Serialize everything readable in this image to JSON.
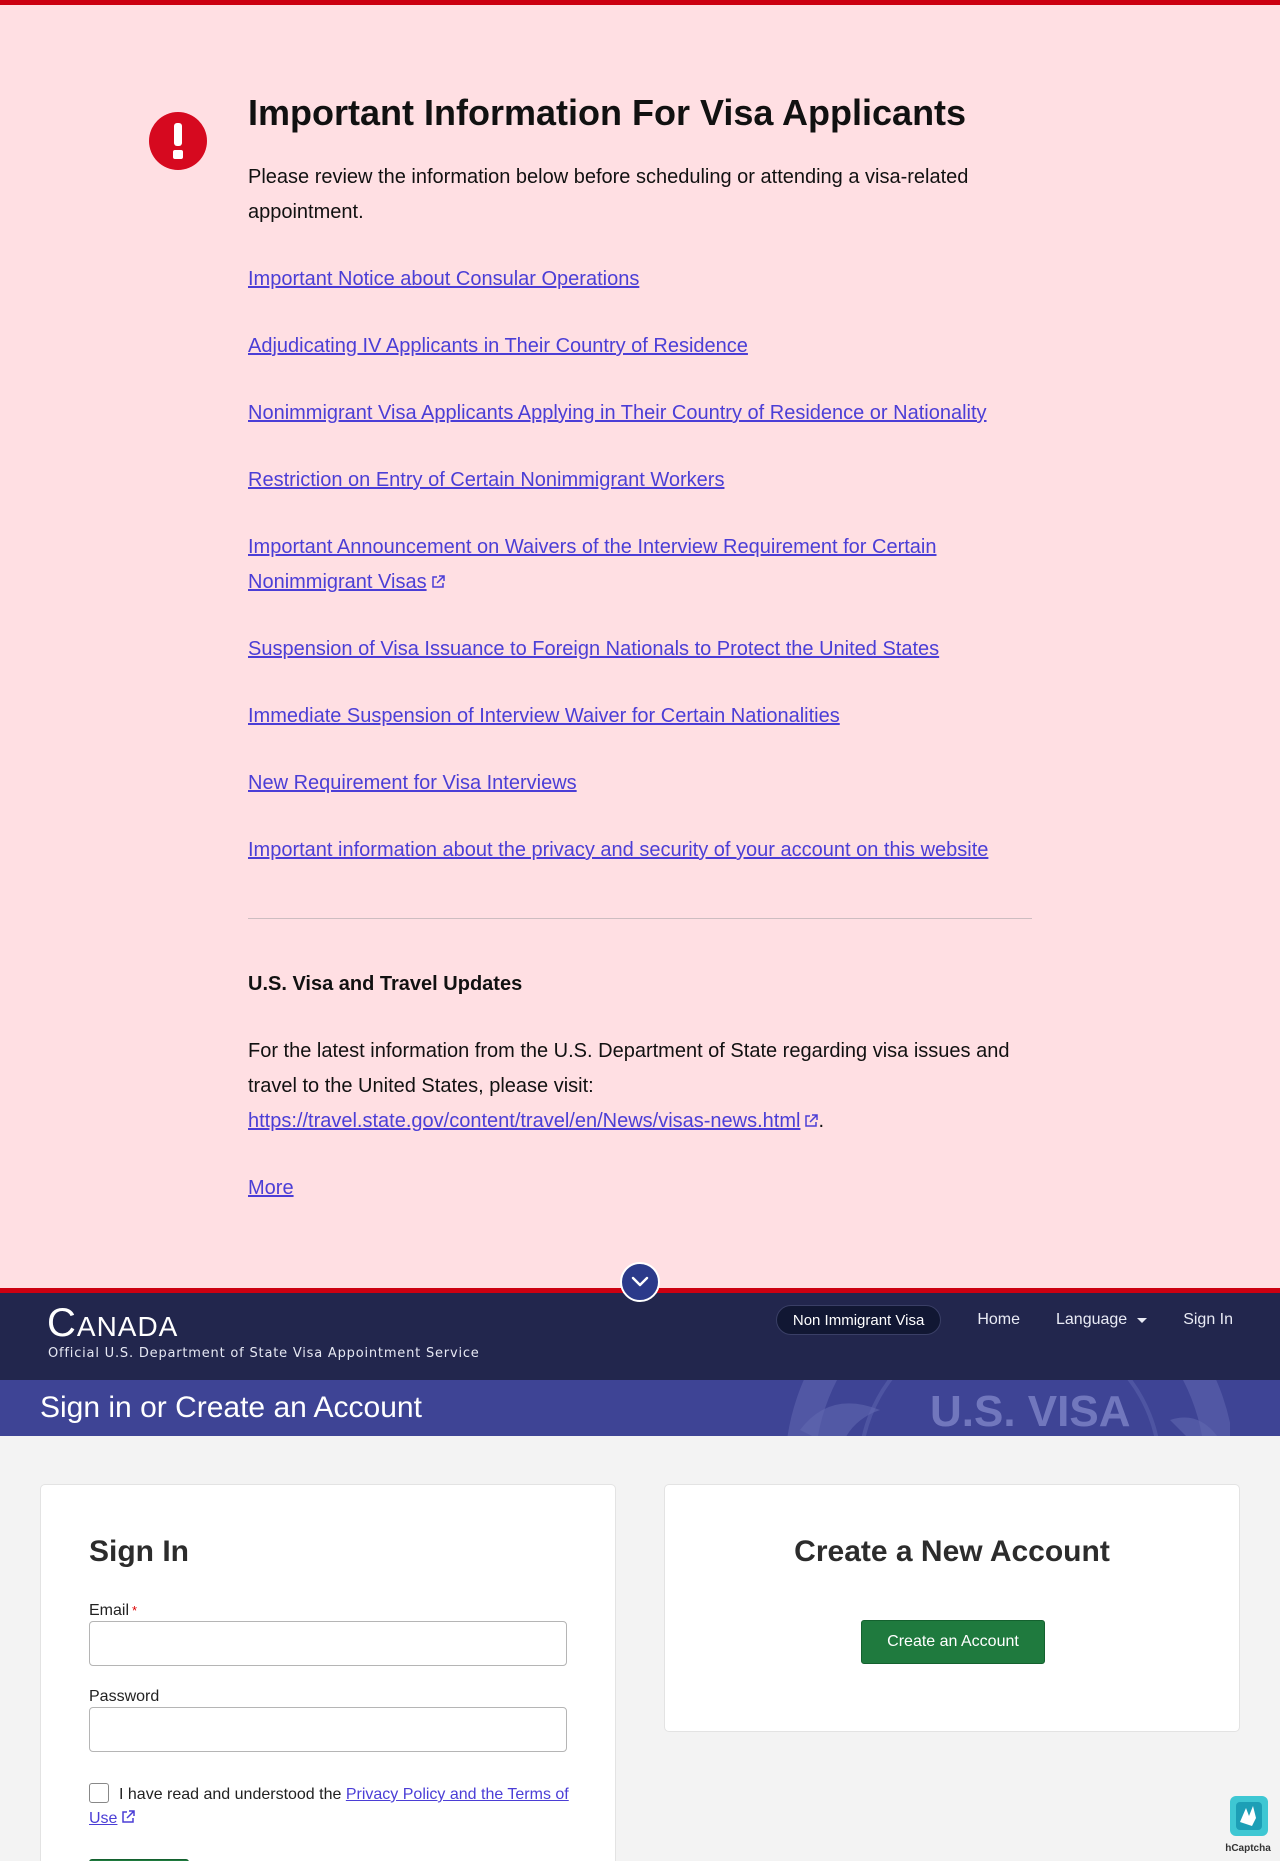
{
  "notice": {
    "title": "Important Information For Visa Applicants",
    "intro": "Please review the information below before scheduling or attending a visa-related appointment.",
    "links": [
      {
        "label": "Important Notice about Consular Operations",
        "external": false
      },
      {
        "label": "Adjudicating IV Applicants in Their Country of Residence",
        "external": false
      },
      {
        "label": "Nonimmigrant Visa Applicants Applying in Their Country of Residence or Nationality",
        "external": false
      },
      {
        "label": "Restriction on Entry of Certain Nonimmigrant Workers",
        "external": false
      },
      {
        "label": "Important Announcement on Waivers of the Interview Requirement for Certain Nonimmigrant Visas",
        "external": true
      },
      {
        "label": "Suspension of Visa Issuance to Foreign Nationals to Protect the United States",
        "external": false
      },
      {
        "label": "Immediate Suspension of Interview Waiver for Certain Nationalities",
        "external": false
      },
      {
        "label": "New Requirement for Visa Interviews",
        "external": false
      },
      {
        "label": "Important information about the privacy and security of your account on this website",
        "external": false
      }
    ],
    "updates_heading": "U.S. Visa and Travel Updates",
    "updates_text": "For the latest information from the U.S. Department of State regarding visa issues and travel to the United States, please visit:",
    "updates_url": "https://travel.state.gov/content/travel/en/News/visas-news.html",
    "updates_period": ".",
    "more_label": "More"
  },
  "header": {
    "country_initial": "C",
    "country_rest": "ANADA",
    "subtitle": "Official U.S. Department of State Visa Appointment Service",
    "nav": {
      "visa_type": "Non Immigrant Visa",
      "home": "Home",
      "language": "Language",
      "sign_in": "Sign In"
    }
  },
  "title_bar": {
    "title": "Sign in or Create an Account",
    "seal_text": "U.S. VISA"
  },
  "signin": {
    "heading": "Sign In",
    "email_label": "Email",
    "required_mark": "*",
    "email_value": "",
    "password_label": "Password",
    "password_value": "",
    "consent_prefix": "I have read and understood the ",
    "consent_link": "Privacy Policy and the Terms of Use"
  },
  "create": {
    "heading": "Create a New Account",
    "button_label": "Create an Account"
  },
  "captcha": {
    "label": "hCaptcha"
  },
  "colors": {
    "notice_bg": "#ffdfe3",
    "alert_red": "#d6091f",
    "link": "#4b3ed6",
    "header_bg": "#22264d",
    "title_bar_bg": "#3e4495",
    "button_green": "#1f7a3e"
  }
}
